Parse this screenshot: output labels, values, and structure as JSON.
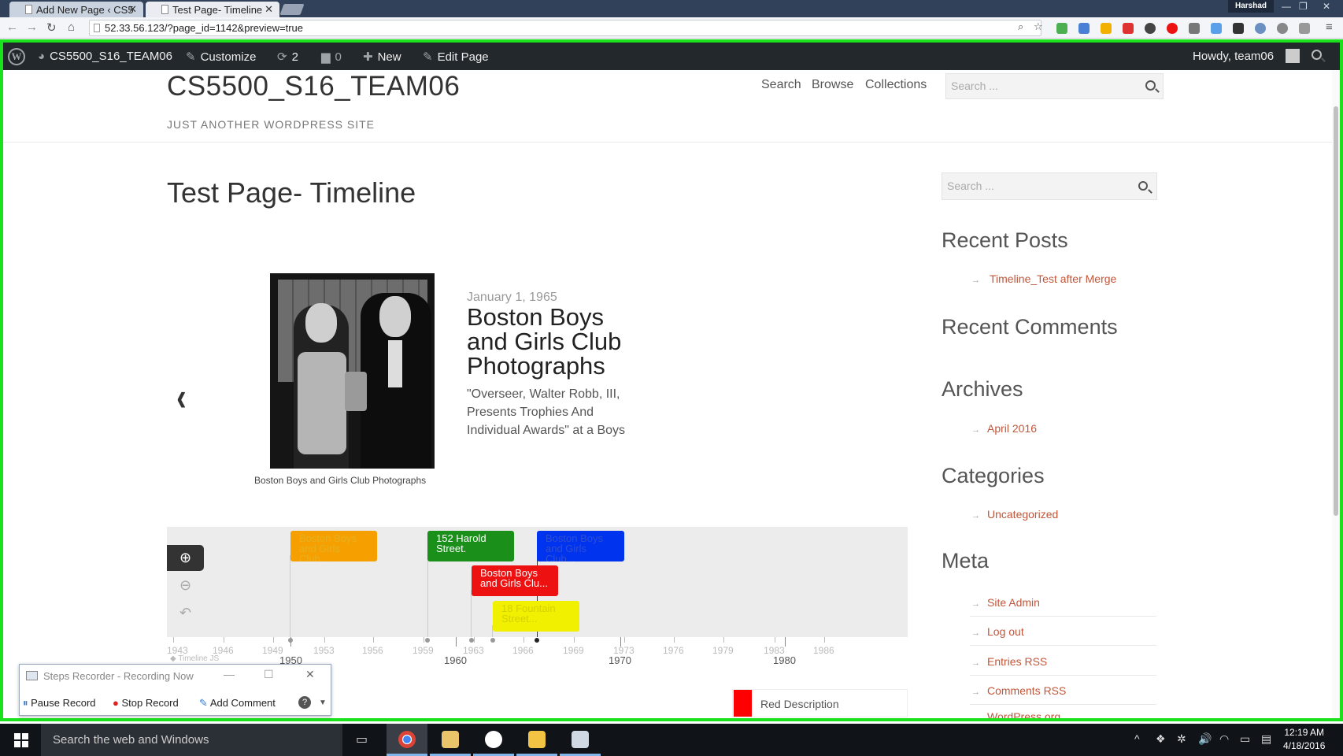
{
  "browser": {
    "tabs": [
      {
        "label": "Add New Page ‹ CS5"
      },
      {
        "label": "Test Page- Timeline"
      }
    ],
    "user_badge": "Harshad",
    "url": "52.33.56.123/?page_id=1142&preview=true"
  },
  "adminbar": {
    "site_name": "CS5500_S16_TEAM06",
    "customize": "Customize",
    "updates_count": "2",
    "comments_count": "0",
    "new_label": "New",
    "edit_page": "Edit Page",
    "howdy": "Howdy, team06"
  },
  "site": {
    "title": "CS5500_S16_TEAM06",
    "description": "JUST ANOTHER WORDPRESS SITE",
    "nav": [
      {
        "label": "Search"
      },
      {
        "label": "Browse"
      },
      {
        "label": "Collections"
      }
    ],
    "search_placeholder": "Search ..."
  },
  "page": {
    "title": "Test Page- Timeline"
  },
  "slide": {
    "caption": "Boston Boys and Girls Club Photographs",
    "date": "January 1, 1965",
    "headline": "Boston Boys and Girls Club Photographs",
    "text": "\"Overseer, Walter Robb, III, Presents Trophies And Individual Awards\" at a Boys"
  },
  "timeline": {
    "markers": [
      {
        "label": "Boston Boys and Girls Club...",
        "color": "#f5a000"
      },
      {
        "label": "152 Harold Street.",
        "color": "#1a8f1a"
      },
      {
        "label": "Boston Boys and Girls Club...",
        "color": "#0033ee"
      },
      {
        "label": "Boston Boys and Girls Clu...",
        "color": "#ee1111"
      },
      {
        "label": "18 Fountain Street...",
        "color": "#f0f000"
      }
    ],
    "minor_ticks": [
      "1943",
      "1946",
      "1949",
      "1953",
      "1956",
      "1959",
      "1963",
      "1966",
      "1969",
      "1973",
      "1976",
      "1979",
      "1983",
      "1986"
    ],
    "major_ticks": [
      "1950",
      "1960",
      "1970",
      "1980"
    ],
    "watermark": "Timeline JS",
    "legend": {
      "label": "Red Description",
      "color": "#ff0000"
    }
  },
  "sidebar": {
    "search_placeholder": "Search ...",
    "recent_posts_title": "Recent Posts",
    "recent_posts": [
      {
        "label": "Timeline_Test after Merge"
      }
    ],
    "recent_comments_title": "Recent Comments",
    "archives_title": "Archives",
    "archives": [
      {
        "label": "April 2016"
      }
    ],
    "categories_title": "Categories",
    "categories": [
      {
        "label": "Uncategorized"
      }
    ],
    "meta_title": "Meta",
    "meta": [
      {
        "label": "Site Admin"
      },
      {
        "label": "Log out"
      },
      {
        "label": "Entries RSS"
      },
      {
        "label": "Comments RSS"
      },
      {
        "label": "WordPress.org"
      }
    ]
  },
  "steps_recorder": {
    "title": "Steps Recorder - Recording Now",
    "pause": "Pause Record",
    "stop": "Stop Record",
    "add_comment": "Add Comment"
  },
  "taskbar": {
    "search_placeholder": "Search the web and Windows",
    "time": "12:19 AM",
    "date": "4/18/2016"
  }
}
